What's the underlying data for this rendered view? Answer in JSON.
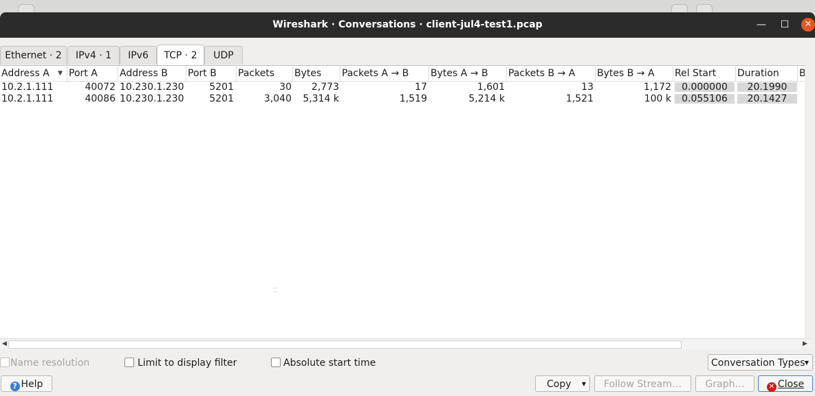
{
  "window": {
    "title": "Wireshark · Conversations · client-jul4-test1.pcap"
  },
  "tabs": [
    {
      "label": "Ethernet · 2",
      "active": false
    },
    {
      "label": "IPv4 · 1",
      "active": false
    },
    {
      "label": "IPv6",
      "active": false
    },
    {
      "label": "TCP · 2",
      "active": true
    },
    {
      "label": "UDP",
      "active": false
    }
  ],
  "table": {
    "columns": [
      "Address A",
      "Port A",
      "Address B",
      "Port B",
      "Packets",
      "Bytes",
      "Packets A → B",
      "Bytes A → B",
      "Packets B → A",
      "Bytes B → A",
      "Rel Start",
      "Duration",
      "Bi"
    ],
    "rows": [
      [
        "10.2.1.111",
        "40072",
        "10.230.1.230",
        "5201",
        "30",
        "2,773",
        "17",
        "1,601",
        "13",
        "1,172",
        "0.000000",
        "20.1990"
      ],
      [
        "10.2.1.111",
        "40086",
        "10.230.1.230",
        "5201",
        "3,040",
        "5,314 k",
        "1,519",
        "5,214 k",
        "1,521",
        "100 k",
        "0.055106",
        "20.1427"
      ]
    ]
  },
  "options": {
    "name_resolution": {
      "label": "Name resolution",
      "checked": false,
      "enabled": false
    },
    "limit_filter": {
      "label": "Limit to display filter",
      "checked": false
    },
    "absolute_time": {
      "label": "Absolute start time",
      "checked": false
    }
  },
  "buttons": {
    "conversation_types": "Conversation Types",
    "help": "Help",
    "copy": "Copy",
    "follow_stream": "Follow Stream…",
    "graph": "Graph…",
    "close": "Close"
  },
  "colors": {
    "titlebar": "#2b2b2b",
    "close_accent": "#e95420",
    "bar_fill": "#d8d8d8"
  }
}
